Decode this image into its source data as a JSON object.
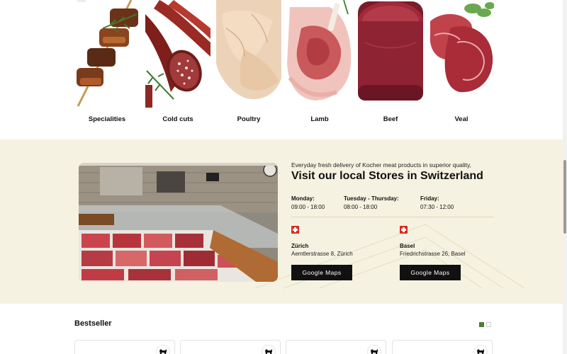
{
  "categories": [
    {
      "label": "Specialities",
      "image": "skewers-image"
    },
    {
      "label": "Cold cuts",
      "image": "salami-image"
    },
    {
      "label": "Poultry",
      "image": "chicken-image"
    },
    {
      "label": "Lamb",
      "image": "lamb-chop-image"
    },
    {
      "label": "Beef",
      "image": "beef-steak-image"
    },
    {
      "label": "Veal",
      "image": "veal-image"
    }
  ],
  "stores": {
    "intro": "Everyday fresh delivery of Kocher meat products in superior quality,",
    "heading": "Visit our local Stores in Switzerland",
    "hours": [
      {
        "day": "Monday:",
        "time": "09:00 - 18:00"
      },
      {
        "day": "Tuesday - Thursday:",
        "time": "08:00 - 18:00"
      },
      {
        "day": "Friday:",
        "time": "07:30 - 12:00"
      }
    ],
    "locations": [
      {
        "city": "Zürich",
        "address": "Aemtlerstrasse 8, Zürich",
        "button": "Google Maps",
        "flag": "swiss-flag-icon"
      },
      {
        "city": "Basel",
        "address": "Friedrichstrasse 26, Basel",
        "button": "Google Maps",
        "flag": "swiss-flag-icon"
      }
    ],
    "colors": {
      "background": "#f6f2e1",
      "flag": "#d52b1e",
      "button": "#111111"
    }
  },
  "bestseller": {
    "title": "Bestseller",
    "pager": {
      "pages": 2,
      "active": 1
    },
    "accent": "#4f7a3a",
    "card_icon": "cow-icon"
  }
}
